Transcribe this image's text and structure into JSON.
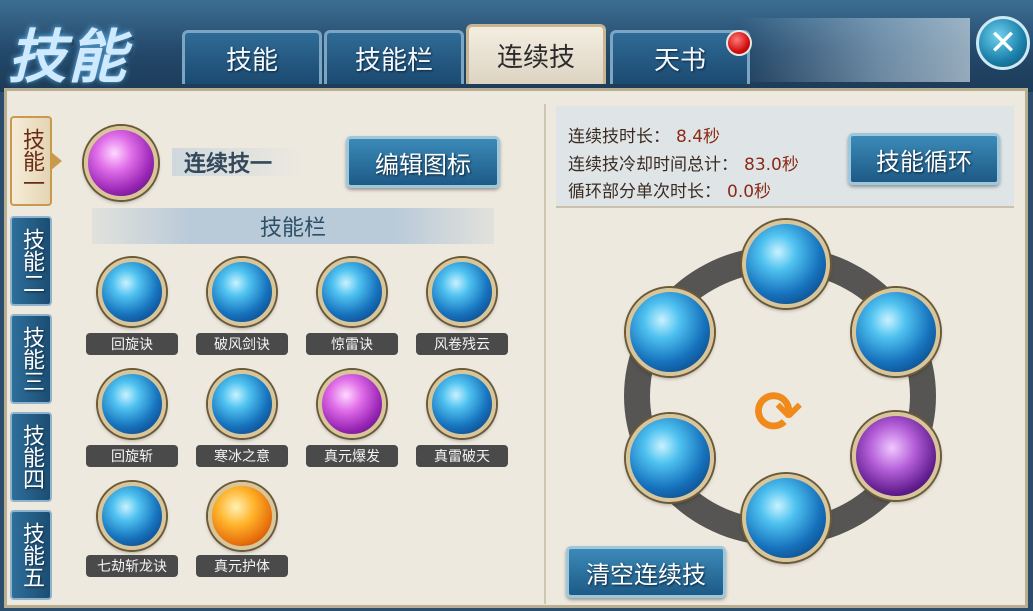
{
  "header": {
    "title": "技能",
    "tabs": [
      {
        "label": "技能"
      },
      {
        "label": "技能栏"
      },
      {
        "label": "连续技"
      },
      {
        "label": "天书"
      }
    ]
  },
  "side_tabs": [
    {
      "label": "技能一"
    },
    {
      "label": "技能二"
    },
    {
      "label": "技能三"
    },
    {
      "label": "技能四"
    },
    {
      "label": "技能五"
    }
  ],
  "combo": {
    "name": "连续技一",
    "edit_icon_button": "编辑图标",
    "skill_bar_title": "技能栏"
  },
  "skills": [
    {
      "label": "回旋诀",
      "icon": "blue-slash-icon"
    },
    {
      "label": "破风剑诀",
      "icon": "wind-lines-icon"
    },
    {
      "label": "惊雷诀",
      "icon": "lightning-icon"
    },
    {
      "label": "风卷残云",
      "icon": "vortex-icon"
    },
    {
      "label": "回旋斩",
      "icon": "ice-blade-icon"
    },
    {
      "label": "寒冰之意",
      "icon": "ice-crystal-icon"
    },
    {
      "label": "真元爆发",
      "icon": "purple-burst-icon"
    },
    {
      "label": "真雷破天",
      "icon": "thunder-strike-icon"
    },
    {
      "label": "七劫斩龙诀",
      "icon": "water-pillar-icon"
    },
    {
      "label": "真元护体",
      "icon": "orange-shield-icon"
    }
  ],
  "stats": {
    "duration_label": "连续技时长：",
    "duration_value": "8.4秒",
    "cooldown_label": "连续技冷却时间总计：",
    "cooldown_value": "83.0秒",
    "loop_label": "循环部分单次时长：",
    "loop_value": "0.0秒"
  },
  "skill_cycle_button": "技能循环",
  "clear_button": "清空连续技",
  "colors": {
    "accent_blue": "#1e5a86",
    "panel_bg": "#ede9df",
    "value_red": "#8b2a15",
    "cycle_orange": "#f08a1c",
    "badge_red": "#d10f0f"
  }
}
